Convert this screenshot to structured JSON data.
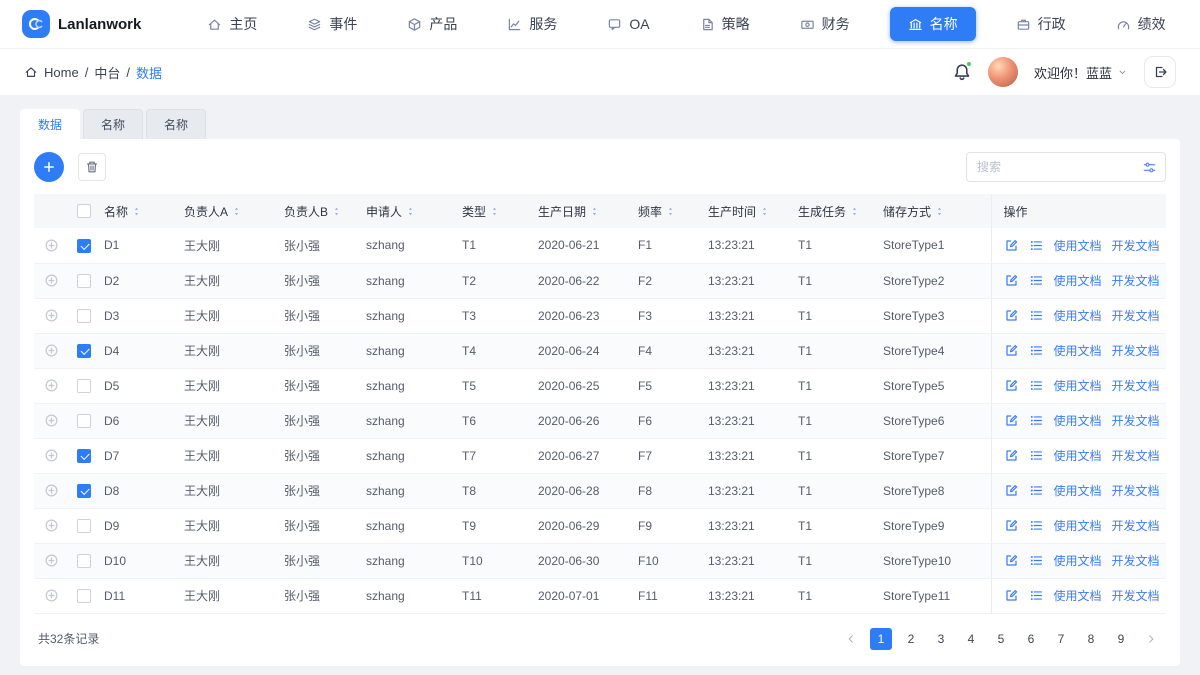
{
  "brand": {
    "name": "Lanlanwork"
  },
  "nav": {
    "items": [
      {
        "label": "主页",
        "icon": "home-icon",
        "active": false
      },
      {
        "label": "事件",
        "icon": "layers-icon",
        "active": false
      },
      {
        "label": "产品",
        "icon": "box-icon",
        "active": false
      },
      {
        "label": "服务",
        "icon": "chart-icon",
        "active": false
      },
      {
        "label": "OA",
        "icon": "message-icon",
        "active": false
      },
      {
        "label": "策略",
        "icon": "document-icon",
        "active": false
      },
      {
        "label": "财务",
        "icon": "money-icon",
        "active": false
      },
      {
        "label": "名称",
        "icon": "bank-icon",
        "active": true
      },
      {
        "label": "行政",
        "icon": "briefcase-icon",
        "active": false
      },
      {
        "label": "绩效",
        "icon": "gauge-icon",
        "active": false
      }
    ]
  },
  "breadcrumb": {
    "items": [
      "Home",
      "中台"
    ],
    "current": "数据",
    "separator": "/"
  },
  "header": {
    "greeting": "欢迎你！蓝蓝"
  },
  "tabs": [
    {
      "label": "数据",
      "active": true
    },
    {
      "label": "名称",
      "active": false
    },
    {
      "label": "名称",
      "active": false
    }
  ],
  "toolbar": {
    "search_placeholder": "搜索"
  },
  "table": {
    "headers": [
      {
        "label": "名称"
      },
      {
        "label": "负责人A"
      },
      {
        "label": "负责人B"
      },
      {
        "label": "申请人"
      },
      {
        "label": "类型"
      },
      {
        "label": "生产日期"
      },
      {
        "label": "频率"
      },
      {
        "label": "生产时间"
      },
      {
        "label": "生成任务"
      },
      {
        "label": "储存方式"
      }
    ],
    "op_header": "操作",
    "op_links": {
      "use": "使用文档",
      "dev": "开发文档"
    },
    "rows": [
      {
        "checked": true,
        "cells": [
          "D1",
          "王大刚",
          "张小强",
          "szhang",
          "T1",
          "2020-06-21",
          "F1",
          "13:23:21",
          "T1",
          "StoreType1"
        ]
      },
      {
        "checked": false,
        "cells": [
          "D2",
          "王大刚",
          "张小强",
          "szhang",
          "T2",
          "2020-06-22",
          "F2",
          "13:23:21",
          "T1",
          "StoreType2"
        ]
      },
      {
        "checked": false,
        "cells": [
          "D3",
          "王大刚",
          "张小强",
          "szhang",
          "T3",
          "2020-06-23",
          "F3",
          "13:23:21",
          "T1",
          "StoreType3"
        ]
      },
      {
        "checked": true,
        "cells": [
          "D4",
          "王大刚",
          "张小强",
          "szhang",
          "T4",
          "2020-06-24",
          "F4",
          "13:23:21",
          "T1",
          "StoreType4"
        ]
      },
      {
        "checked": false,
        "cells": [
          "D5",
          "王大刚",
          "张小强",
          "szhang",
          "T5",
          "2020-06-25",
          "F5",
          "13:23:21",
          "T1",
          "StoreType5"
        ]
      },
      {
        "checked": false,
        "cells": [
          "D6",
          "王大刚",
          "张小强",
          "szhang",
          "T6",
          "2020-06-26",
          "F6",
          "13:23:21",
          "T1",
          "StoreType6"
        ]
      },
      {
        "checked": true,
        "cells": [
          "D7",
          "王大刚",
          "张小强",
          "szhang",
          "T7",
          "2020-06-27",
          "F7",
          "13:23:21",
          "T1",
          "StoreType7"
        ]
      },
      {
        "checked": true,
        "cells": [
          "D8",
          "王大刚",
          "张小强",
          "szhang",
          "T8",
          "2020-06-28",
          "F8",
          "13:23:21",
          "T1",
          "StoreType8"
        ]
      },
      {
        "checked": false,
        "cells": [
          "D9",
          "王大刚",
          "张小强",
          "szhang",
          "T9",
          "2020-06-29",
          "F9",
          "13:23:21",
          "T1",
          "StoreType9"
        ]
      },
      {
        "checked": false,
        "cells": [
          "D10",
          "王大刚",
          "张小强",
          "szhang",
          "T10",
          "2020-06-30",
          "F10",
          "13:23:21",
          "T1",
          "StoreType10"
        ]
      },
      {
        "checked": false,
        "cells": [
          "D11",
          "王大刚",
          "张小强",
          "szhang",
          "T11",
          "2020-07-01",
          "F11",
          "13:23:21",
          "T1",
          "StoreType11"
        ]
      }
    ]
  },
  "pagination": {
    "total_text": "共32条记录",
    "pages": [
      {
        "label": "1",
        "active": true
      },
      {
        "label": "2",
        "active": false
      },
      {
        "label": "3",
        "active": false
      },
      {
        "label": "4",
        "active": false
      },
      {
        "label": "5",
        "active": false
      },
      {
        "label": "6",
        "active": false
      },
      {
        "label": "7",
        "active": false
      },
      {
        "label": "8",
        "active": false
      },
      {
        "label": "9",
        "active": false
      }
    ]
  },
  "colors": {
    "primary": "#2e7cf6",
    "link": "#3a7cf7",
    "notification_dot": "#43d15c"
  }
}
